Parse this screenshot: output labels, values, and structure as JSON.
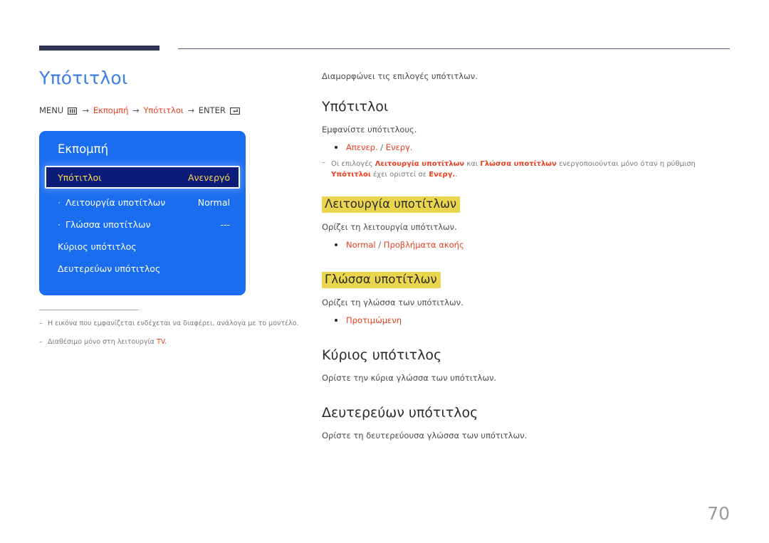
{
  "header": {
    "rule_thick_color": "#2f3552",
    "rule_thin_color": "#5d5f76"
  },
  "left": {
    "page_title": "Υπότιτλοι",
    "breadcrumb": {
      "menu_label": "MENU",
      "menu_icon": "menu-grid-icon",
      "arrow": "→",
      "item1": "Εκπομπή",
      "item2": "Υπότιτλοι",
      "enter_label": "ENTER",
      "enter_icon": "enter-key-icon"
    },
    "osd": {
      "title": "Εκπομπή",
      "rows": [
        {
          "label": "Υπότιτλοι",
          "value": "Ανενεργό",
          "selected": true,
          "sub": false
        },
        {
          "label": "Λειτουργία υποτίτλων",
          "value": "Normal",
          "selected": false,
          "sub": true
        },
        {
          "label": "Γλώσσα υποτίτλων",
          "value": "---",
          "selected": false,
          "sub": true
        },
        {
          "label": "Κύριος υπότιτλος",
          "value": "",
          "selected": false,
          "sub": false
        },
        {
          "label": "Δευτερεύων υπότιτλος",
          "value": "",
          "selected": false,
          "sub": false
        }
      ],
      "bg_color": "#1b6df0",
      "selected_bg_color": "#0c1d79",
      "selected_text_color": "#ffd74d"
    },
    "footnotes": [
      {
        "text": "Η εικόνα που εμφανίζεται ενδέχεται να διαφέρει, ανάλογα με το μοντέλο.",
        "highlight": ""
      },
      {
        "text_before": "Διαθέσιμο μόνο στη λειτουργία ",
        "highlight": "TV",
        "text_after": "."
      }
    ]
  },
  "right": {
    "intro": "Διαμορφώνει τις επιλογές υπότιτλων.",
    "sections": [
      {
        "title": "Υπότιτλοι",
        "highlighted": false,
        "body": "Εμφανίστε υπότιτλους.",
        "options": [
          {
            "a": "Απενερ.",
            "sep": " / ",
            "b": "Ενεργ."
          }
        ],
        "note": {
          "p1": "Οι επιλογές ",
          "h1": "Λειτουργία υποτίτλων",
          "p2": " και ",
          "h2": "Γλώσσα υποτίτλων",
          "p3": " ενεργοποιούνται μόνο όταν η ρύθμιση ",
          "h3": "Υπότιτλοι",
          "p4": " έχει οριστεί σε ",
          "h4": "Ενεργ.",
          "p5": "."
        }
      },
      {
        "title": "Λειτουργία υποτίτλων",
        "highlighted": true,
        "body": "Ορίζει τη λειτουργία υπότιτλων.",
        "options": [
          {
            "a": "Normal",
            "sep": " / ",
            "b": "Προβλήματα ακοής"
          }
        ]
      },
      {
        "title": "Γλώσσα υποτίτλων",
        "highlighted": true,
        "body": "Ορίζει τη γλώσσα των υπότιτλων.",
        "options": [
          {
            "a": "Προτιμώμενη",
            "sep": "",
            "b": ""
          }
        ]
      },
      {
        "title": "Κύριος υπότιτλος",
        "highlighted": false,
        "body": "Ορίστε την κύρια γλώσσα των υπότιτλων.",
        "options": []
      },
      {
        "title": "Δευτερεύων υπότιτλος",
        "highlighted": false,
        "body": "Ορίστε τη δευτερεύουσα γλώσσα των υπότιτλων.",
        "options": []
      }
    ]
  },
  "page_number": "70",
  "colors": {
    "title_blue": "#3d7eea",
    "accent_red": "#e8401f",
    "highlight_yellow": "#ead64e",
    "page_num_gray": "#9b9b9b"
  }
}
